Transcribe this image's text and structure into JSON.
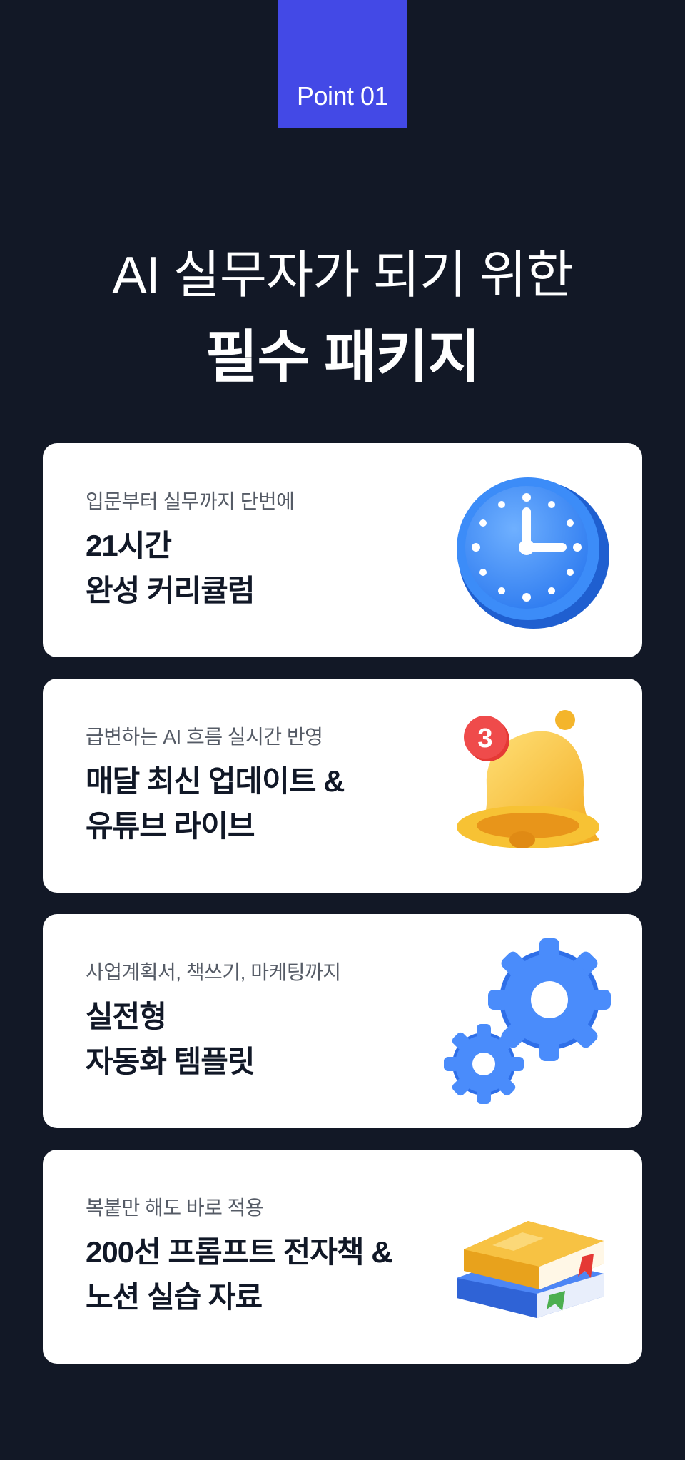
{
  "badge": {
    "label": "Point 01",
    "color": "#4349e6"
  },
  "headline": {
    "line1": "AI 실무자가 되기 위한",
    "line2": "필수 패키지"
  },
  "cards": [
    {
      "subtitle": "입문부터 실무까지 단번에",
      "title_line1": "21시간",
      "title_line2": "완성 커리큘럼",
      "icon": "clock-icon"
    },
    {
      "subtitle": "급변하는 AI 흐름 실시간 반영",
      "title_line1": "매달 최신 업데이트 &",
      "title_line2": "유튜브 라이브",
      "icon": "bell-icon",
      "notification_count": "3"
    },
    {
      "subtitle": "사업계획서, 책쓰기, 마케팅까지",
      "title_line1": "실전형",
      "title_line2": "자동화 템플릿",
      "icon": "gears-icon"
    },
    {
      "subtitle": "복붙만 해도 바로 적용",
      "title_line1": "200선 프롬프트 전자책 &",
      "title_line2": "노션 실습 자료",
      "icon": "books-icon"
    }
  ],
  "colors": {
    "background": "#121826",
    "card": "#ffffff",
    "title_text": "#111827",
    "subtitle_text": "#555b66",
    "accent_blue": "#3b82f6",
    "accent_yellow": "#f6c744",
    "accent_red": "#e53935"
  }
}
